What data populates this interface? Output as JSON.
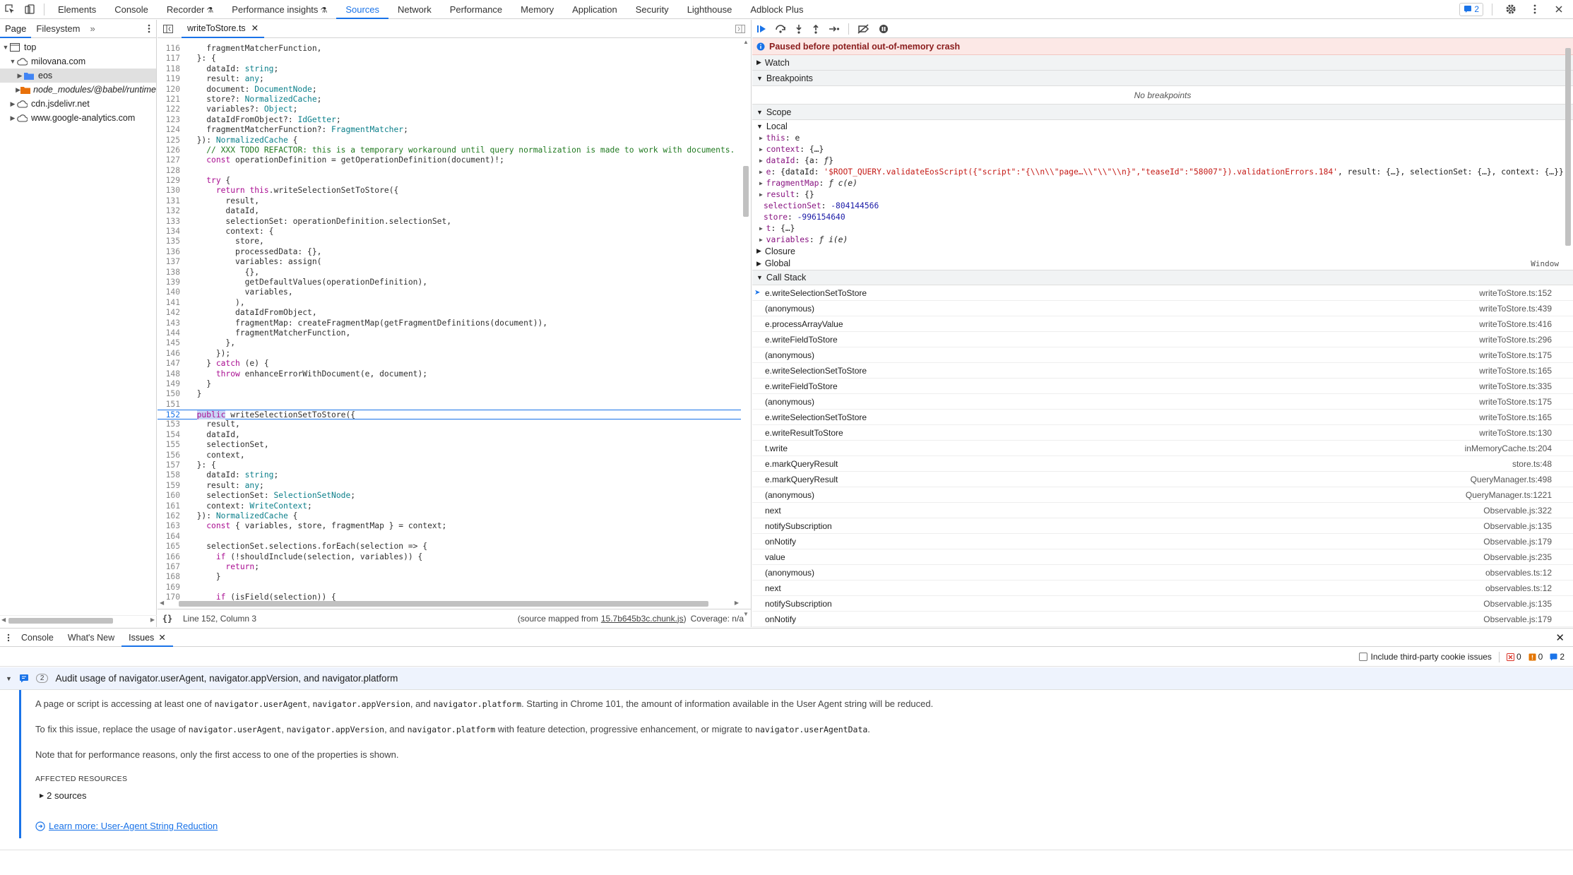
{
  "top_tabs": [
    "Elements",
    "Console",
    "Recorder",
    "Performance insights",
    "Sources",
    "Network",
    "Performance",
    "Memory",
    "Application",
    "Security",
    "Lighthouse",
    "Adblock Plus"
  ],
  "active_tab": "Sources",
  "issues_count": "2",
  "navigator": {
    "tabs": [
      "Page",
      "Filesystem"
    ],
    "more": "»",
    "tree": [
      {
        "label": "top",
        "level": 0,
        "open": true,
        "icon": "frame-icon"
      },
      {
        "label": "milovana.com",
        "level": 1,
        "open": true,
        "icon": "cloud-icon"
      },
      {
        "label": "eos",
        "level": 2,
        "open": false,
        "icon": "folder-icon",
        "selected": true
      },
      {
        "label": "node_modules/@babel/runtime",
        "level": 2,
        "open": false,
        "icon": "folder-icon",
        "italic": true
      },
      {
        "label": "cdn.jsdelivr.net",
        "level": 1,
        "open": false,
        "icon": "cloud-icon"
      },
      {
        "label": "www.google-analytics.com",
        "level": 1,
        "open": false,
        "icon": "cloud-icon"
      }
    ]
  },
  "editor": {
    "file_tab": "writeToStore.ts",
    "status_position": "Line 152, Column 3",
    "source_mapped_prefix": "(source mapped from",
    "source_mapped_file": "15.7b645b3c.chunk.js",
    "source_mapped_suffix": ")",
    "coverage": "Coverage: n/a",
    "lines": [
      {
        "n": "116",
        "html": "    fragmentMatcherFunction,"
      },
      {
        "n": "117",
        "html": "  }: {"
      },
      {
        "n": "118",
        "html": "    dataId: <span class=\"ty\">string</span>;"
      },
      {
        "n": "119",
        "html": "    result: <span class=\"ty\">any</span>;"
      },
      {
        "n": "120",
        "html": "    document: <span class=\"ty\">DocumentNode</span>;"
      },
      {
        "n": "121",
        "html": "    store?: <span class=\"ty\">NormalizedCache</span>;"
      },
      {
        "n": "122",
        "html": "    variables?: <span class=\"ty\">Object</span>;"
      },
      {
        "n": "123",
        "html": "    dataIdFromObject?: <span class=\"ty\">IdGetter</span>;"
      },
      {
        "n": "124",
        "html": "    fragmentMatcherFunction?: <span class=\"ty\">FragmentMatcher</span>;"
      },
      {
        "n": "125",
        "html": "  }): <span class=\"ty\">NormalizedCache</span> {"
      },
      {
        "n": "126",
        "html": "    <span class=\"cm\">// XXX TODO REFACTOR: this is a temporary workaround until query normalization is made to work with documents.</span>"
      },
      {
        "n": "127",
        "html": "    <span class=\"kw\">const</span> operationDefinition = getOperationDefinition(document)!;"
      },
      {
        "n": "128",
        "html": ""
      },
      {
        "n": "129",
        "html": "    <span class=\"kw\">try</span> {"
      },
      {
        "n": "130",
        "html": "      <span class=\"kw\">return</span> <span class=\"kw\">this</span>.writeSelectionSetToStore({"
      },
      {
        "n": "131",
        "html": "        result,"
      },
      {
        "n": "132",
        "html": "        dataId,"
      },
      {
        "n": "133",
        "html": "        selectionSet: operationDefinition.selectionSet,"
      },
      {
        "n": "134",
        "html": "        context: {"
      },
      {
        "n": "135",
        "html": "          store,"
      },
      {
        "n": "136",
        "html": "          processedData: {},"
      },
      {
        "n": "137",
        "html": "          variables: assign("
      },
      {
        "n": "138",
        "html": "            {},"
      },
      {
        "n": "139",
        "html": "            getDefaultValues(operationDefinition),"
      },
      {
        "n": "140",
        "html": "            variables,"
      },
      {
        "n": "141",
        "html": "          ),"
      },
      {
        "n": "142",
        "html": "          dataIdFromObject,"
      },
      {
        "n": "143",
        "html": "          fragmentMap: createFragmentMap(getFragmentDefinitions(document)),"
      },
      {
        "n": "144",
        "html": "          fragmentMatcherFunction,"
      },
      {
        "n": "145",
        "html": "        },"
      },
      {
        "n": "146",
        "html": "      });"
      },
      {
        "n": "147",
        "html": "    } <span class=\"kw\">catch</span> (e) {"
      },
      {
        "n": "148",
        "html": "      <span class=\"kw\">throw</span> enhanceErrorWithDocument(e, document);"
      },
      {
        "n": "149",
        "html": "    }"
      },
      {
        "n": "150",
        "html": "  }"
      },
      {
        "n": "151",
        "html": ""
      },
      {
        "n": "152",
        "html": "  <span class=\"kw hlw\">public</span> writeSelectionSetToStore({",
        "hl": true
      },
      {
        "n": "153",
        "html": "    result,"
      },
      {
        "n": "154",
        "html": "    dataId,"
      },
      {
        "n": "155",
        "html": "    selectionSet,"
      },
      {
        "n": "156",
        "html": "    context,"
      },
      {
        "n": "157",
        "html": "  }: {"
      },
      {
        "n": "158",
        "html": "    dataId: <span class=\"ty\">string</span>;"
      },
      {
        "n": "159",
        "html": "    result: <span class=\"ty\">any</span>;"
      },
      {
        "n": "160",
        "html": "    selectionSet: <span class=\"ty\">SelectionSetNode</span>;"
      },
      {
        "n": "161",
        "html": "    context: <span class=\"ty\">WriteContext</span>;"
      },
      {
        "n": "162",
        "html": "  }): <span class=\"ty\">NormalizedCache</span> {"
      },
      {
        "n": "163",
        "html": "    <span class=\"kw\">const</span> { variables, store, fragmentMap } = context;"
      },
      {
        "n": "164",
        "html": ""
      },
      {
        "n": "165",
        "html": "    selectionSet.selections.forEach(selection => {"
      },
      {
        "n": "166",
        "html": "      <span class=\"kw\">if</span> (!shouldInclude(selection, variables)) {"
      },
      {
        "n": "167",
        "html": "        <span class=\"kw\">return</span>;"
      },
      {
        "n": "168",
        "html": "      }"
      },
      {
        "n": "169",
        "html": ""
      },
      {
        "n": "170",
        "html": "      <span class=\"kw\">if</span> (isField(selection)) {"
      }
    ]
  },
  "debugger": {
    "paused_message": "Paused before potential out-of-memory crash",
    "watch_label": "Watch",
    "breakpoints_label": "Breakpoints",
    "no_breakpoints": "No breakpoints",
    "scope_label": "Scope",
    "local_label": "Local",
    "scope_rows": [
      {
        "arrow": "▶",
        "html": "<span class=\"pk\">this</span>: e"
      },
      {
        "arrow": "▶",
        "html": "<span class=\"pk\">context</span>: {…}"
      },
      {
        "arrow": "▶",
        "html": "<span class=\"pk\">dataId</span>: {a: <i>ƒ</i>}"
      },
      {
        "arrow": "▶",
        "html": "<span class=\"pk\">e</span>: {dataId: <span class=\"ps\">'$ROOT_QUERY.validateEosScript({\"script\":\"{\\\\n\\\\\"page…\\\\\"\\\\\"\\\\n}\",\"teaseId\":\"58007\"}).validationErrors.184'</span>, result: {…}, selectionSet: {…}, context: {…}}"
      },
      {
        "arrow": "▶",
        "html": "<span class=\"pk\">fragmentMap</span>: <i>ƒ c(e)</i>"
      },
      {
        "arrow": "▶",
        "html": "<span class=\"pk\">result</span>: {}"
      },
      {
        "arrow": "",
        "html": "<span class=\"pk\">selectionSet</span>: <span class=\"pv\">-804144566</span>"
      },
      {
        "arrow": "",
        "html": "<span class=\"pk\">store</span>: <span class=\"pv\">-996154640</span>"
      },
      {
        "arrow": "▶",
        "html": "<span class=\"pk\">t</span>: {…}"
      },
      {
        "arrow": "▶",
        "html": "<span class=\"pk\">variables</span>: <i>ƒ i(e)</i>"
      }
    ],
    "closure_label": "Closure",
    "global_label": "Global",
    "global_value": "Window",
    "callstack_label": "Call Stack",
    "frames": [
      {
        "fn": "e.writeSelectionSetToStore",
        "loc": "writeToStore.ts:152",
        "current": true
      },
      {
        "fn": "(anonymous)",
        "loc": "writeToStore.ts:439"
      },
      {
        "fn": "e.processArrayValue",
        "loc": "writeToStore.ts:416"
      },
      {
        "fn": "e.writeFieldToStore",
        "loc": "writeToStore.ts:296"
      },
      {
        "fn": "(anonymous)",
        "loc": "writeToStore.ts:175"
      },
      {
        "fn": "e.writeSelectionSetToStore",
        "loc": "writeToStore.ts:165"
      },
      {
        "fn": "e.writeFieldToStore",
        "loc": "writeToStore.ts:335"
      },
      {
        "fn": "(anonymous)",
        "loc": "writeToStore.ts:175"
      },
      {
        "fn": "e.writeSelectionSetToStore",
        "loc": "writeToStore.ts:165"
      },
      {
        "fn": "e.writeResultToStore",
        "loc": "writeToStore.ts:130"
      },
      {
        "fn": "t.write",
        "loc": "inMemoryCache.ts:204"
      },
      {
        "fn": "e.markQueryResult",
        "loc": "store.ts:48"
      },
      {
        "fn": "e.markQueryResult",
        "loc": "QueryManager.ts:498"
      },
      {
        "fn": "(anonymous)",
        "loc": "QueryManager.ts:1221"
      },
      {
        "fn": "next",
        "loc": "Observable.js:322"
      },
      {
        "fn": "notifySubscription",
        "loc": "Observable.js:135"
      },
      {
        "fn": "onNotify",
        "loc": "Observable.js:179"
      },
      {
        "fn": "value",
        "loc": "Observable.js:235"
      },
      {
        "fn": "(anonymous)",
        "loc": "observables.ts:12"
      },
      {
        "fn": "next",
        "loc": "observables.ts:12"
      },
      {
        "fn": "notifySubscription",
        "loc": "Observable.js:135"
      },
      {
        "fn": "onNotify",
        "loc": "Observable.js:179"
      }
    ]
  },
  "drawer": {
    "tabs": [
      "Console",
      "What's New",
      "Issues"
    ],
    "active": "Issues",
    "include_third_party": "Include third-party cookie issues",
    "counts": {
      "errors": "0",
      "warnings": "0",
      "info": "2"
    },
    "issue": {
      "count": "2",
      "title": "Audit usage of navigator.userAgent, navigator.appVersion, and navigator.platform",
      "p1_pre": "A page or script is accessing at least one of ",
      "code_ua": "navigator.userAgent",
      "code_av": "navigator.appVersion",
      "code_pl": "navigator.platform",
      "code_uad": "navigator.userAgentData",
      "sep_comma": ", ",
      "sep_and": ", and ",
      "p1_post": ". Starting in Chrome 101, the amount of information available in the User Agent string will be reduced.",
      "p2_pre": "To fix this issue, replace the usage of ",
      "p2_mid": " with feature detection, progressive enhancement, or migrate to ",
      "p2_end": ".",
      "p3": "Note that for performance reasons, only the first access to one of the properties is shown.",
      "affected_label": "AFFECTED RESOURCES",
      "sources": "2 sources",
      "learn_more": "Learn more: User-Agent String Reduction"
    }
  }
}
